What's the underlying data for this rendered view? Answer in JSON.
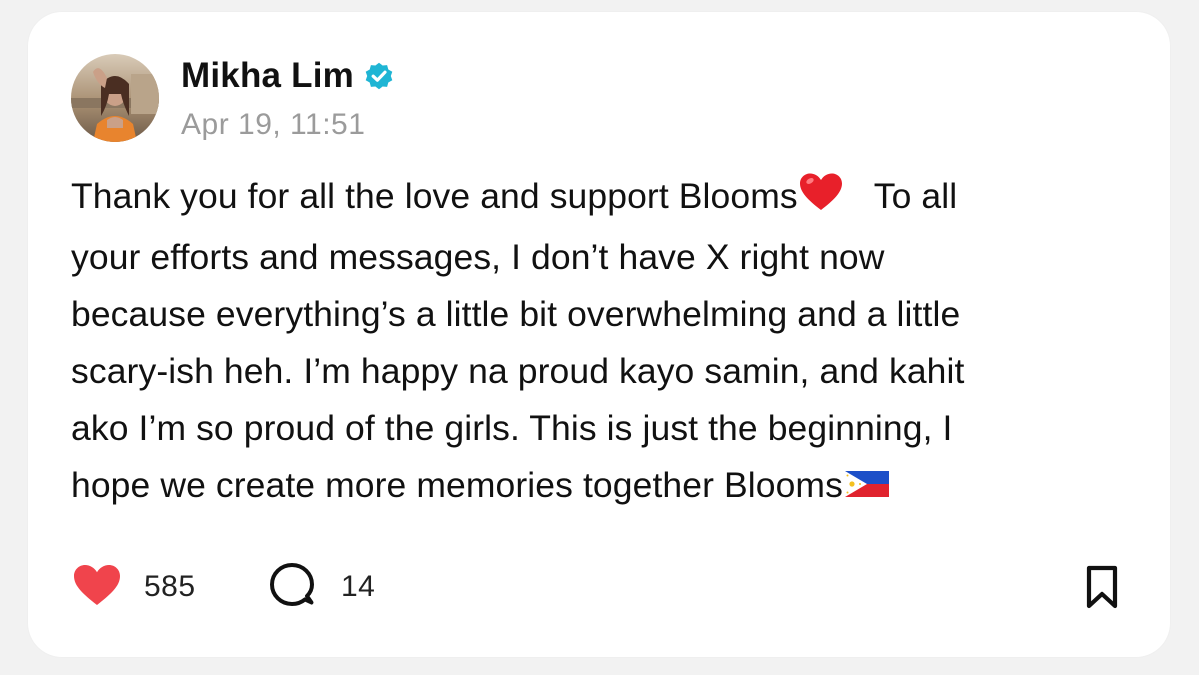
{
  "post": {
    "author": {
      "name": "Mikha Lim",
      "verified": true,
      "verified_color": "#1fb5d4"
    },
    "timestamp": "Apr 19, 11:51",
    "body_lines": [
      "Thank you for all the love and support Blooms",
      "To all",
      "your efforts and messages, I don’t have X right now",
      "because everything’s a little bit overwhelming and a little",
      "scary-ish heh. I’m happy na proud kayo samin, and kahit",
      "ako I’m so proud of the girls. This is just the beginning, I",
      "hope we create more memories together Blooms"
    ],
    "emojis": [
      "red-heart-emoji",
      "philippines-flag-emoji"
    ],
    "actions": {
      "likes": "585",
      "comments": "14",
      "like_color": "#f0444c"
    }
  }
}
